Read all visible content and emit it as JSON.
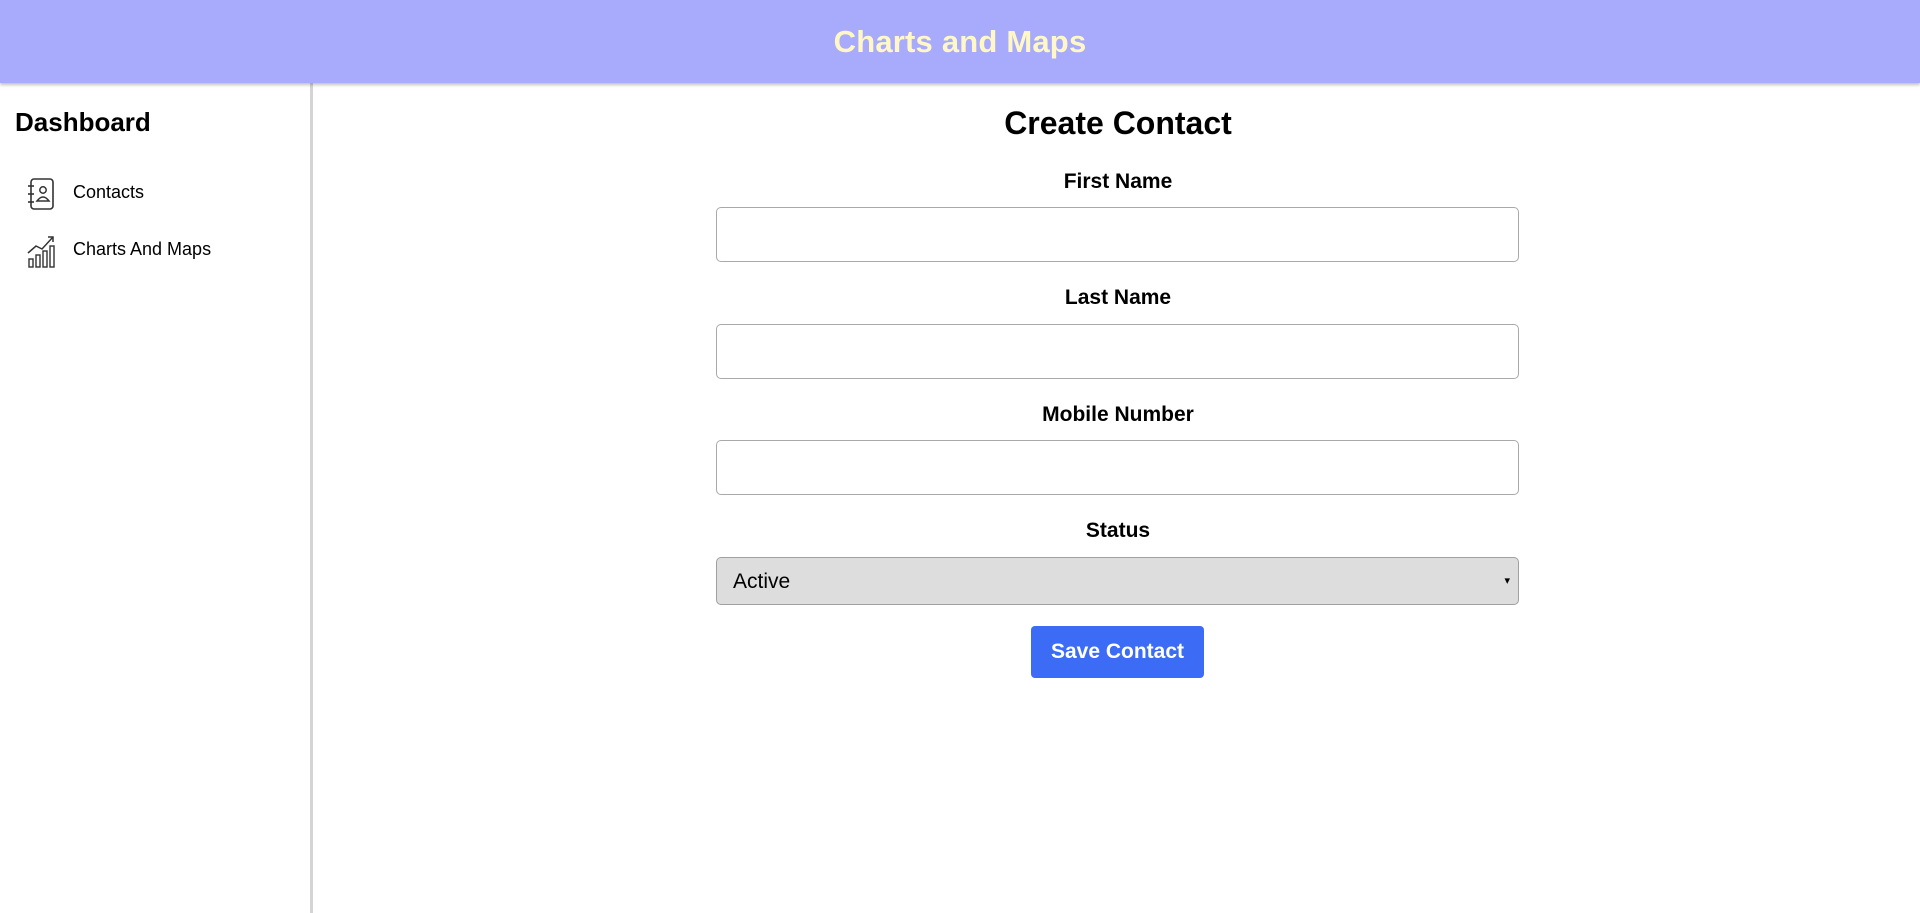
{
  "header": {
    "title": "Charts and Maps"
  },
  "sidebar": {
    "title": "Dashboard",
    "items": [
      {
        "label": "Contacts",
        "icon": "contacts-book-icon"
      },
      {
        "label": "Charts And Maps",
        "icon": "bar-chart-trend-icon"
      }
    ]
  },
  "form": {
    "title": "Create Contact",
    "first_name": {
      "label": "First Name",
      "value": ""
    },
    "last_name": {
      "label": "Last Name",
      "value": ""
    },
    "mobile": {
      "label": "Mobile Number",
      "value": ""
    },
    "status": {
      "label": "Status",
      "selected": "Active",
      "caret": "▾"
    },
    "save_label": "Save Contact"
  },
  "colors": {
    "header_bg": "#a8aafc",
    "header_text": "#fff8c6",
    "button_bg": "#3c6cf5",
    "select_bg": "#dddddd"
  }
}
